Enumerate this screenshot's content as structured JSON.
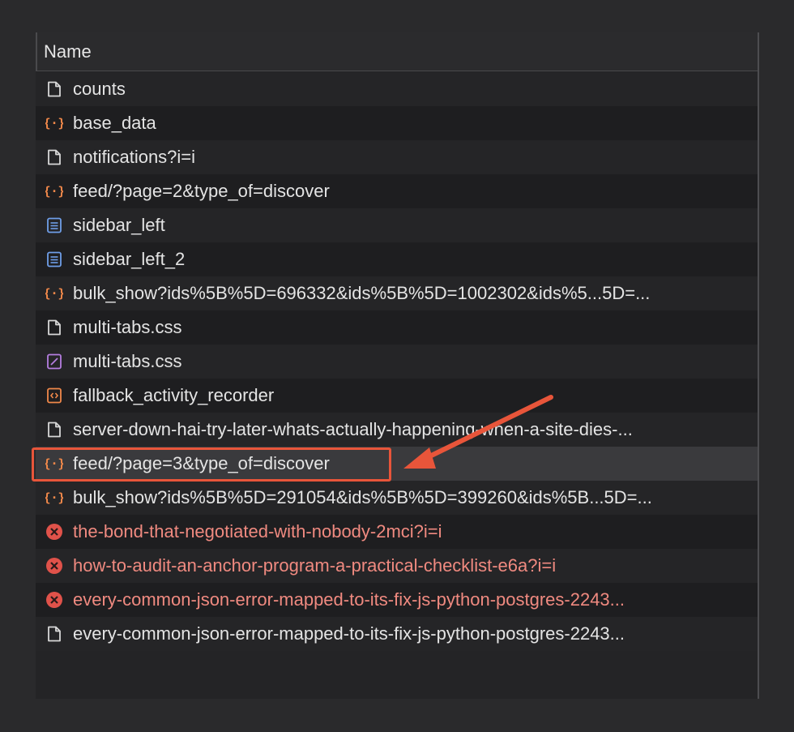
{
  "table": {
    "header": "Name",
    "rows": [
      {
        "label": "counts",
        "icon": "document-icon",
        "status": "normal"
      },
      {
        "label": "base_data",
        "icon": "json-braces-icon",
        "status": "normal"
      },
      {
        "label": "notifications?i=i",
        "icon": "document-icon",
        "status": "normal"
      },
      {
        "label": "feed/?page=2&type_of=discover",
        "icon": "json-braces-icon",
        "status": "normal"
      },
      {
        "label": "sidebar_left",
        "icon": "html-document-icon",
        "status": "normal"
      },
      {
        "label": "sidebar_left_2",
        "icon": "html-document-icon",
        "status": "normal"
      },
      {
        "label": "bulk_show?ids%5B%5D=696332&ids%5B%5D=1002302&ids%5...5D=...",
        "icon": "json-braces-icon",
        "status": "normal"
      },
      {
        "label": "multi-tabs.css",
        "icon": "document-icon",
        "status": "normal"
      },
      {
        "label": "multi-tabs.css",
        "icon": "stylesheet-icon",
        "status": "normal"
      },
      {
        "label": "fallback_activity_recorder",
        "icon": "script-icon",
        "status": "normal"
      },
      {
        "label": "server-down-hai-try-later-whats-actually-happening-when-a-site-dies-...",
        "icon": "document-icon",
        "status": "normal"
      },
      {
        "label": "feed/?page=3&type_of=discover",
        "icon": "json-braces-icon",
        "status": "selected"
      },
      {
        "label": "bulk_show?ids%5B%5D=291054&ids%5B%5D=399260&ids%5B...5D=...",
        "icon": "json-braces-icon",
        "status": "normal"
      },
      {
        "label": "the-bond-that-negotiated-with-nobody-2mci?i=i",
        "icon": "error-icon",
        "status": "error"
      },
      {
        "label": "how-to-audit-an-anchor-program-a-practical-checklist-e6a?i=i",
        "icon": "error-icon",
        "status": "error"
      },
      {
        "label": "every-common-json-error-mapped-to-its-fix-js-python-postgres-2243...",
        "icon": "error-icon",
        "status": "error"
      },
      {
        "label": "every-common-json-error-mapped-to-its-fix-js-python-postgres-2243...",
        "icon": "document-icon",
        "status": "normal"
      }
    ]
  },
  "colors": {
    "background": "#2a2a2c",
    "error_text": "#f08a80",
    "json_icon": "#f0884a",
    "html_icon": "#6f9ee8",
    "css_icon": "#b57ee0",
    "script_icon": "#f0884a",
    "error_icon": "#e0524a",
    "highlight": "#e8553a"
  },
  "annotation": {
    "type": "arrow-pointing-to-selected-row"
  }
}
